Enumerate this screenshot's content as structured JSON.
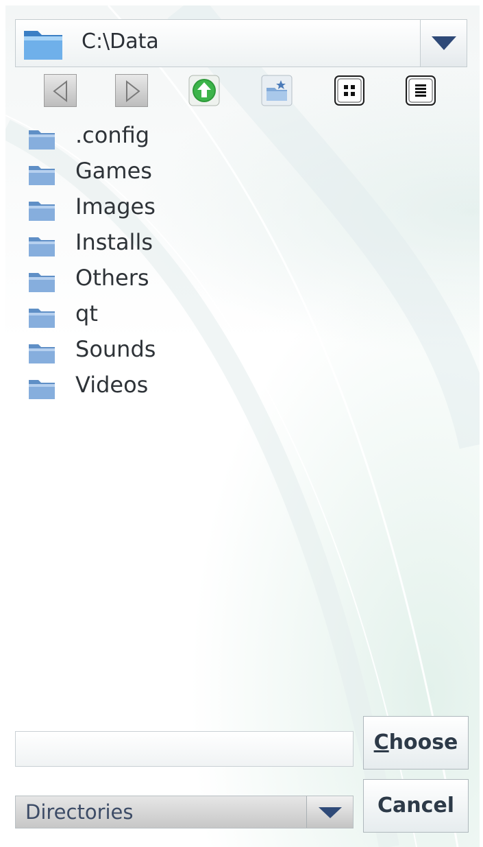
{
  "path": {
    "current": "C:\\Data"
  },
  "toolbar": {
    "back": "back-icon",
    "forward": "forward-icon",
    "up": "up-arrow-icon",
    "new_folder": "new-folder-icon",
    "icon_view": "icon-view-icon",
    "list_view": "list-view-icon"
  },
  "folders": [
    ".config",
    "Games",
    "Images",
    "Installs",
    "Others",
    "qt",
    "Sounds",
    "Videos"
  ],
  "filename": {
    "value": "",
    "placeholder": ""
  },
  "buttons": {
    "choose_accel": "C",
    "choose_rest": "hoose",
    "cancel": "Cancel"
  },
  "filter": {
    "selected": "Directories"
  },
  "colors": {
    "arrow": "#2f4a78",
    "up_button": "#2e9a3a",
    "folder": "#7fa8d8"
  }
}
